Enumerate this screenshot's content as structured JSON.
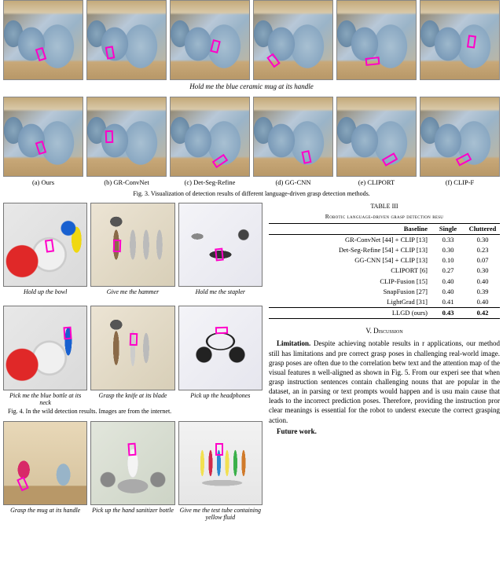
{
  "fig3": {
    "prompt": "Hold me the blue ceramic mug at its handle",
    "columns": [
      "(a) Ours",
      "(b) GR-ConvNet",
      "(c) Det-Seg-Refine",
      "(d) GG-CNN",
      "(e) CLIPORT",
      "(f) CLIP-F"
    ],
    "caption": "Fig. 3.   Visualization of detection results of different language-driven grasp detection methods."
  },
  "fig4": {
    "items": [
      {
        "caption": "Hold up the bowl"
      },
      {
        "caption": "Give me the hammer"
      },
      {
        "caption": "Hold me the stapler"
      },
      {
        "caption": "Pick me the blue bottle at its neck"
      },
      {
        "caption": "Grasp the knife at its blade"
      },
      {
        "caption": "Pick up the headphones"
      }
    ],
    "caption": "Fig. 4.   In the wild detection results. Images are from the internet."
  },
  "fig5": {
    "items": [
      {
        "caption": "Grasp the mug at its handle"
      },
      {
        "caption": "Pick up the hand sanitizer bottle"
      },
      {
        "caption": "Give me the test tube containing yellow fluid"
      }
    ]
  },
  "table3": {
    "label": "TABLE III",
    "title": "Robotic language-driven grasp detection resu",
    "headers": [
      "Baseline",
      "Single",
      "Cluttered"
    ],
    "rows": [
      {
        "name": "GR-ConvNet [44] + CLIP [13]",
        "single": "0.33",
        "cluttered": "0.30"
      },
      {
        "name": "Det-Seg-Refine [54] + CLIP [13]",
        "single": "0.30",
        "cluttered": "0.23"
      },
      {
        "name": "GG-CNN [54] + CLIP [13]",
        "single": "0.10",
        "cluttered": "0.07"
      },
      {
        "name": "CLIPORT [6]",
        "single": "0.27",
        "cluttered": "0.30"
      },
      {
        "name": "CLIP-Fusion [15]",
        "single": "0.40",
        "cluttered": "0.40"
      },
      {
        "name": "SnapFusion [27]",
        "single": "0.40",
        "cluttered": "0.39"
      },
      {
        "name": "LightGrad [31]",
        "single": "0.41",
        "cluttered": "0.40"
      }
    ],
    "final": {
      "name": "LLGD (ours)",
      "single": "0.43",
      "cluttered": "0.42"
    }
  },
  "discussion": {
    "heading": "V.  Discussion",
    "limitation_lead": "Limitation.",
    "limitation_body": " Despite achieving notable results in r applications, our method still has limitations and pre correct grasp poses in challenging real-world image. grasp poses are often due to the correlation betw text and the attention map of the visual features n well-aligned as shown in Fig. 5. From our experi see that when grasp instruction sentences contain challenging nouns that are popular in the dataset, an in parsing or text prompts would happen and is usu main cause that leads to the incorrect prediction poses. Therefore, providing the instruction pror clear meanings is essential for the robot to underst execute the correct grasping action.",
    "future_lead": "Future work."
  }
}
